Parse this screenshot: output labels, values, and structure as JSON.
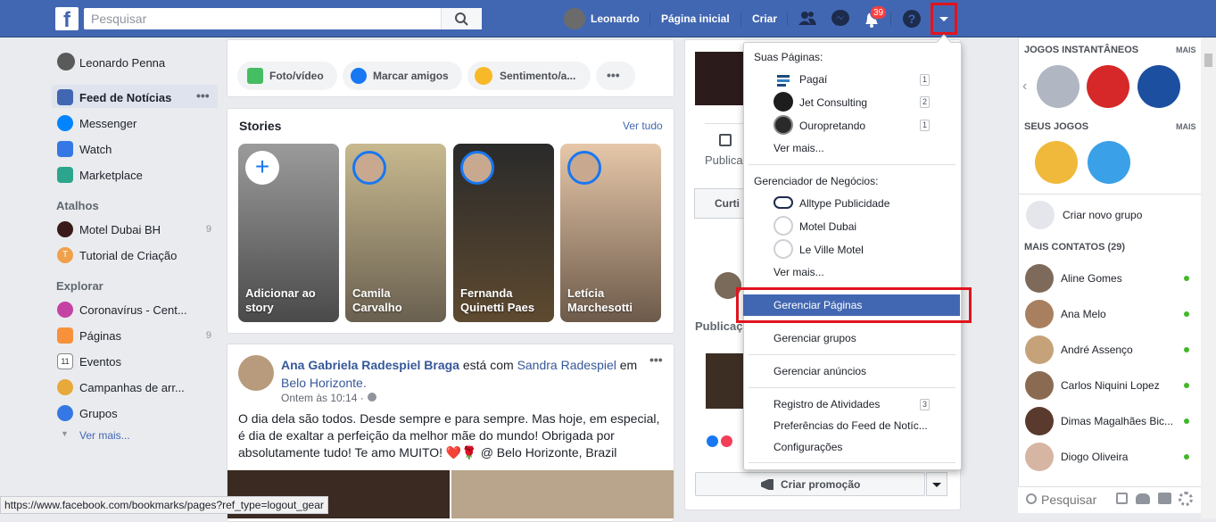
{
  "topbar": {
    "logo": "f",
    "search_placeholder": "Pesquisar",
    "user_name": "Leonardo",
    "home_label": "Página inicial",
    "create_label": "Criar",
    "notif_count": "39"
  },
  "left_nav": {
    "profile_name": "Leonardo Penna",
    "main_items": [
      {
        "label": "Feed de Notícias",
        "icon": "news-feed-icon"
      },
      {
        "label": "Messenger",
        "icon": "messenger-icon"
      },
      {
        "label": "Watch",
        "icon": "watch-icon"
      },
      {
        "label": "Marketplace",
        "icon": "marketplace-icon"
      }
    ],
    "shortcuts_title": "Atalhos",
    "shortcuts": [
      {
        "label": "Motel Dubai BH",
        "count": "9"
      },
      {
        "label": "Tutorial de Criação",
        "count": ""
      }
    ],
    "explore_title": "Explorar",
    "explore": [
      {
        "label": "Coronavírus - Cent...",
        "count": ""
      },
      {
        "label": "Páginas",
        "count": "9"
      },
      {
        "label": "Eventos",
        "count": ""
      },
      {
        "label": "Campanhas de arr...",
        "count": ""
      },
      {
        "label": "Grupos",
        "count": ""
      }
    ],
    "see_more": "Ver mais..."
  },
  "composer": {
    "photo_label": "Foto/vídeo",
    "tag_label": "Marcar amigos",
    "feeling_label": "Sentimento/a..."
  },
  "stories": {
    "title": "Stories",
    "see_all": "Ver tudo",
    "items": [
      {
        "name": "Adicionar ao story"
      },
      {
        "name": "Camila Carvalho"
      },
      {
        "name": "Fernanda Quinetti Paes"
      },
      {
        "name": "Letícia Marchesotti"
      }
    ]
  },
  "post": {
    "author": "Ana Gabriela Radespiel Braga",
    "with_text": "está com",
    "friend": "Sandra Radespiel",
    "in_text": "em",
    "place": "Belo Horizonte.",
    "time": "Ontem às 10:14 ·",
    "body": "O dia dela são todos. Desde sempre e para sempre. Mas hoje, em especial, é dia de exaltar a perfeição da melhor mãe do mundo! Obrigada por absolutamente tudo! Te amo MUITO! ❤️🌹 @ Belo Horizonte, Brazil"
  },
  "page_panel": {
    "publish_label": "Publica",
    "like_label": "Curti",
    "publications_label": "Publicaç",
    "promo_label": "Criar promoção"
  },
  "dropdown": {
    "pages_title": "Suas Páginas:",
    "pages": [
      {
        "label": "Pagaí",
        "count": "1"
      },
      {
        "label": "Jet Consulting",
        "count": "2"
      },
      {
        "label": "Ouropretando",
        "count": "1"
      }
    ],
    "pages_more": "Ver mais...",
    "business_title": "Gerenciador de Negócios:",
    "business": [
      {
        "label": "Alltype Publicidade"
      },
      {
        "label": "Motel Dubai"
      },
      {
        "label": "Le Ville Motel"
      }
    ],
    "business_more": "Ver mais...",
    "manage_pages": "Gerenciar Páginas",
    "manage_groups": "Gerenciar grupos",
    "manage_ads": "Gerenciar anúncios",
    "activity_log": "Registro de Atividades",
    "activity_count": "3",
    "feed_prefs": "Preferências do Feed de Notíc...",
    "settings": "Configurações"
  },
  "right_col": {
    "instant_games": "JOGOS INSTANTÂNEOS",
    "more": "MAIS",
    "your_games": "SEUS JOGOS",
    "create_group": "Criar novo grupo",
    "more_contacts": "MAIS CONTATOS (29)",
    "contacts": [
      {
        "name": "Aline Gomes"
      },
      {
        "name": "Ana Melo"
      },
      {
        "name": "André Assenço"
      },
      {
        "name": "Carlos Niquini Lopez"
      },
      {
        "name": "Dimas Magalhães Bic..."
      },
      {
        "name": "Diogo Oliveira"
      }
    ],
    "chat_search_placeholder": "Pesquisar"
  },
  "status_url": "https://www.facebook.com/bookmarks/pages?ref_type=logout_gear"
}
